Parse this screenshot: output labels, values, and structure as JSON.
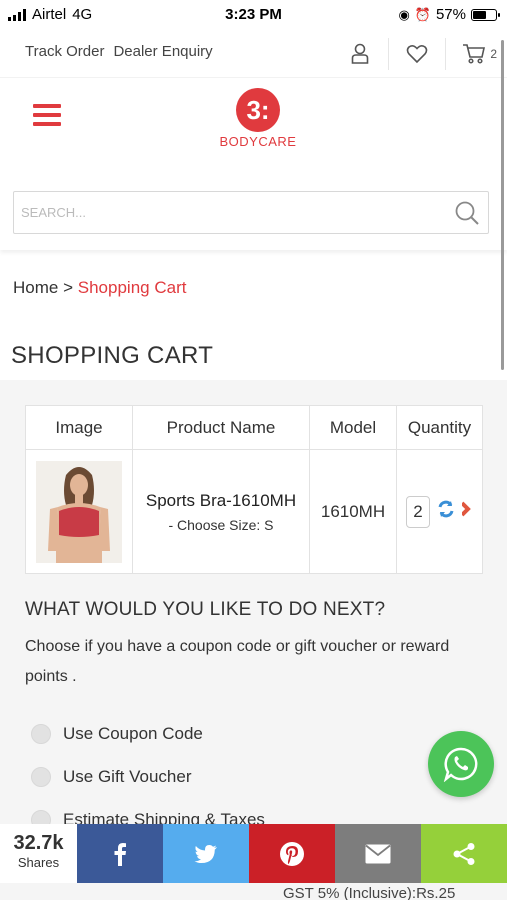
{
  "status": {
    "carrier": "Airtel",
    "network": "4G",
    "time": "3:23 PM",
    "battery": "57%"
  },
  "top_links": {
    "track_order": "Track Order",
    "dealer_enquiry": "Dealer Enquiry",
    "cart_count": "2"
  },
  "logo": {
    "mark": "3:",
    "text": "BODYCARE"
  },
  "search": {
    "placeholder": "SEARCH..."
  },
  "breadcrumb": {
    "home": "Home",
    "separator": ">",
    "current": "Shopping Cart"
  },
  "page_title": "SHOPPING CART",
  "cart": {
    "headers": [
      "Image",
      "Product Name",
      "Model",
      "Quantity"
    ],
    "items": [
      {
        "name": "Sports Bra-1610MH",
        "option": "- Choose Size: S",
        "model": "1610MH",
        "quantity": "2"
      }
    ]
  },
  "next": {
    "title": "WHAT WOULD YOU LIKE TO DO NEXT?",
    "description": "Choose if you have a coupon code or gift voucher or reward points .",
    "options": [
      "Use Coupon Code",
      "Use Gift Voucher",
      "Estimate Shipping & Taxes"
    ]
  },
  "share": {
    "count": "32.7k",
    "label": "Shares"
  },
  "footer_peek": "GST 5% (Inclusive):Rs.25",
  "colors": {
    "brand": "#e03a3e",
    "facebook": "#3b5998",
    "twitter": "#55acee",
    "pinterest": "#cb2027",
    "email": "#7d7d7d",
    "share": "#95d03a",
    "whatsapp": "#4cc459"
  }
}
